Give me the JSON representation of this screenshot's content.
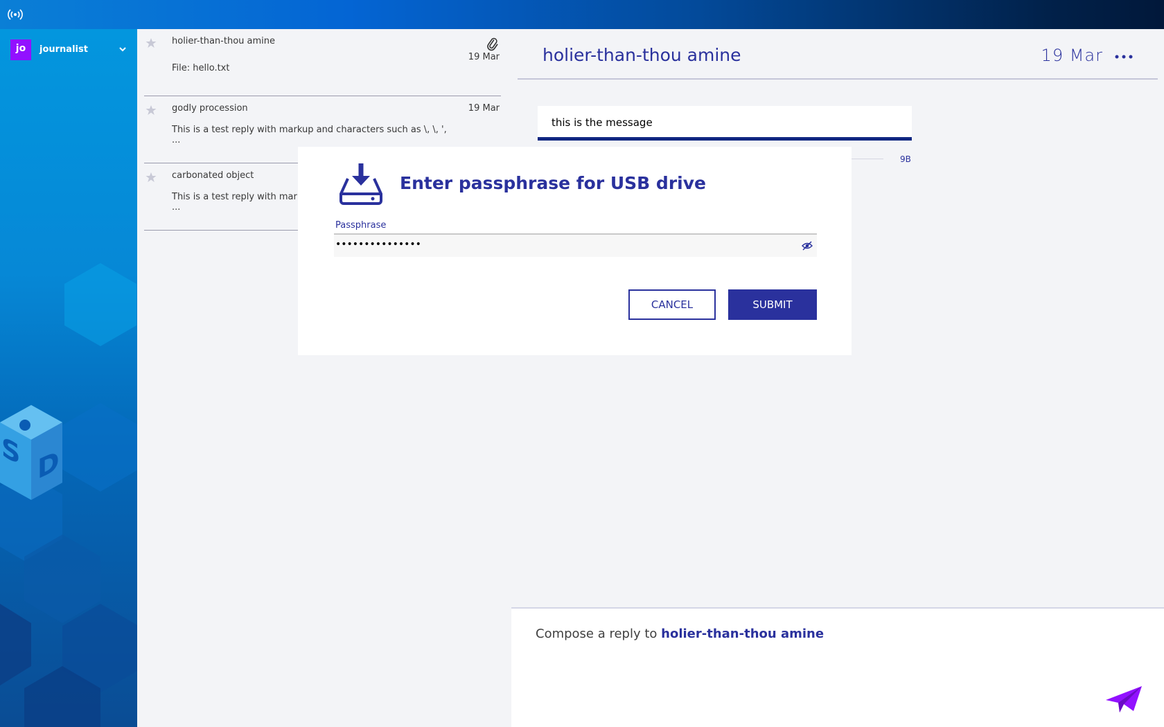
{
  "topbar": {
    "activity_icon": "antenna-icon"
  },
  "user": {
    "initials": "jo",
    "name": "journalist",
    "avatar_color": "#9211ff"
  },
  "sources": [
    {
      "name": "holier-than-thou amine",
      "date": "19 Mar",
      "preview": "File: hello.txt",
      "preview_more": "",
      "has_attachment": true,
      "starred": false
    },
    {
      "name": "godly procession",
      "date": "19 Mar",
      "preview": "This is a test reply with markup and characters such as \\, \\, ',",
      "preview_more": "...",
      "has_attachment": false,
      "starred": false
    },
    {
      "name": "carbonated object",
      "date": "",
      "preview": "This is a test reply with mar",
      "preview_more": "...",
      "has_attachment": false,
      "starred": false
    }
  ],
  "conversation": {
    "title": "holier-than-thou amine",
    "date": "19 Mar",
    "message": "this is the message",
    "file_size": "9B",
    "reply_prefix": "Compose a reply to ",
    "reply_source": "holier-than-thou amine"
  },
  "modal": {
    "title": "Enter passphrase for USB drive",
    "field_label": "Passphrase",
    "field_value": "•••••••••••••••",
    "cancel_label": "CANCEL",
    "submit_label": "SUBMIT"
  },
  "colors": {
    "accent": "#2a319d",
    "send": "#9211ff"
  }
}
